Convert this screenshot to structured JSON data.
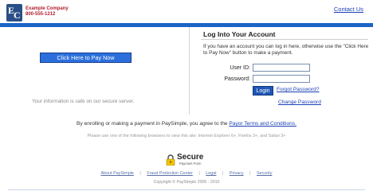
{
  "header": {
    "logo_letter_top": "E",
    "logo_letter_bottom": "C",
    "company_name": "Example Company",
    "company_phone": "800-555-1212",
    "contact_link": "Contact Us"
  },
  "colors": {
    "brand_bar": "#1b64c8",
    "company_text": "#b01e2e",
    "link": "#1a3fb5",
    "pay_button": "#2c6fdc"
  },
  "pay": {
    "button_label": "Click Here to Pay Now",
    "safe_note": "Your information is safe on our secure server."
  },
  "login": {
    "title": "Log Into Your Account",
    "description": "If you have an account you can log in here, otherwise use the \"Click Here to Pay Now\" button to make a payment.",
    "user_id_label": "User ID:",
    "user_id_value": "",
    "password_label": "Password:",
    "password_value": "",
    "login_button": "Login",
    "forgot_link": "Forgot Password?",
    "change_link": "Change Password"
  },
  "agreement": {
    "text": "By enrolling or making a payment in PaySimple, you agree to the",
    "link": "Payor Terms and Conditions.",
    "browsers": "Please use one of the following browsers to view this site: Internet Explorer 6+, Firefox 3+, and Safari 3+"
  },
  "secure_badge": {
    "icon": "lock-icon",
    "title": "Secure",
    "subtitle": "Payment Form"
  },
  "footer": {
    "links": [
      "About PaySimple",
      "Fraud Protection Center",
      "Legal",
      "Privacy",
      "Security"
    ],
    "copyright": "Copyright © PaySimple 2005 - 2010"
  }
}
